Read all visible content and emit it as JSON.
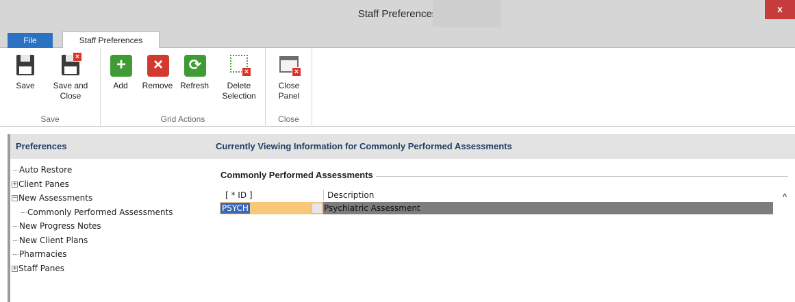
{
  "window": {
    "title": "Staff Preferences",
    "close_glyph": "x"
  },
  "tabs": {
    "file": "File",
    "active": "Staff Preferences"
  },
  "ribbon": {
    "groups": {
      "save": "Save",
      "grid_actions": "Grid Actions",
      "close": "Close"
    },
    "buttons": {
      "save": "Save",
      "save_and_close": "Save and\nClose",
      "add": "Add",
      "remove": "Remove",
      "refresh": "Refresh",
      "delete_selection": "Delete\nSelection",
      "close_panel": "Close\nPanel"
    },
    "icons": {
      "save": "floppy-disk-icon",
      "save_and_close": "floppy-disk-close-icon",
      "add": "plus-icon",
      "remove": "remove-x-icon",
      "refresh": "refresh-icon",
      "delete_selection": "delete-selection-icon",
      "close_panel": "close-panel-icon"
    }
  },
  "preferences": {
    "header": "Preferences",
    "tree": [
      {
        "label": "Auto Restore",
        "expander": ""
      },
      {
        "label": "Client Panes",
        "expander": "+"
      },
      {
        "label": "New Assessments",
        "expander": "−"
      },
      {
        "label": "Commonly Performed Assessments",
        "expander": ""
      },
      {
        "label": "New Progress Notes",
        "expander": ""
      },
      {
        "label": "New Client Plans",
        "expander": ""
      },
      {
        "label": "Pharmacies",
        "expander": ""
      },
      {
        "label": "Staff Panes",
        "expander": "+"
      }
    ]
  },
  "content": {
    "header": "Currently Viewing Information for Commonly Performed Assessments",
    "section_title": "Commonly Performed Assessments",
    "grid": {
      "columns": [
        "[ * ID ]",
        "Description"
      ],
      "rows": [
        {
          "id": "PSYCH",
          "description": "Psychiatric Assessment"
        }
      ]
    },
    "scroll_up_glyph": "^"
  },
  "colors": {
    "file_tab": "#2b72c2",
    "title_close": "#c63c3c",
    "header_text": "#1f3e64",
    "selected_row": "#7d7d7d",
    "id_cell": "#f9c779",
    "id_highlight": "#3a68b8"
  }
}
